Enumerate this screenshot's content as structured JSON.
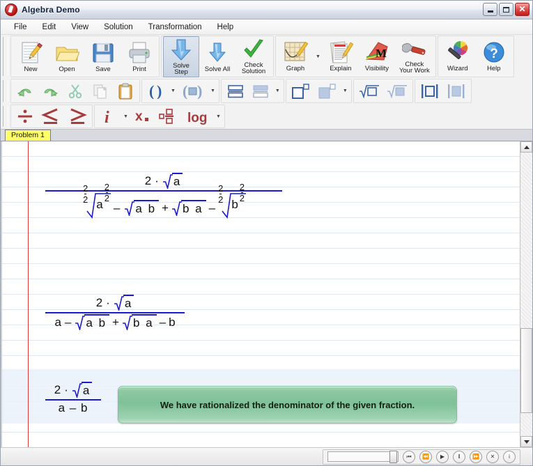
{
  "window": {
    "title": "Algebra Demo",
    "app_icon": "algebra-app-icon",
    "buttons": {
      "minimize": "minimize-button",
      "maximize": "maximize-button",
      "close": "close-button",
      "close_glyph": "✕"
    }
  },
  "menu": {
    "items": [
      "File",
      "Edit",
      "View",
      "Solution",
      "Transformation",
      "Help"
    ]
  },
  "toolbar_row1": {
    "groups": [
      {
        "buttons": [
          {
            "label": "New",
            "icon": "new-document-icon"
          },
          {
            "label": "Open",
            "icon": "open-folder-icon"
          },
          {
            "label": "Save",
            "icon": "floppy-disk-icon"
          },
          {
            "label": "Print",
            "icon": "printer-icon"
          }
        ]
      },
      {
        "buttons": [
          {
            "label": "Solve\nStep",
            "label_line1": "Solve",
            "label_line2": "Step",
            "icon": "solve-step-arrow-icon",
            "state": "active"
          },
          {
            "label": "Solve All",
            "icon": "solve-all-arrow-icon"
          },
          {
            "label": "Check\nSolution",
            "label_line1": "Check",
            "label_line2": "Solution",
            "icon": "green-check-icon"
          }
        ]
      },
      {
        "buttons": [
          {
            "label": "Graph",
            "icon": "graph-plot-icon",
            "has_dropdown": true
          },
          {
            "label": "Explain",
            "icon": "explain-document-icon"
          },
          {
            "label": "Visibility",
            "icon": "visibility-m-icon"
          },
          {
            "label": "Check\nYour Work",
            "label_line1": "Check",
            "label_line2": "Your Work",
            "icon": "wrench-icon"
          }
        ]
      },
      {
        "buttons": [
          {
            "label": "Wizard",
            "icon": "magic-wand-icon"
          },
          {
            "label": "Help",
            "icon": "help-question-icon"
          }
        ]
      }
    ]
  },
  "toolbar_row2": {
    "groups": [
      {
        "buttons": [
          {
            "icon": "undo-icon",
            "glyph": "↶",
            "disabled": false
          },
          {
            "icon": "redo-icon",
            "glyph": "↷",
            "disabled": false
          },
          {
            "icon": "scissors-cut-icon",
            "glyph": "✂",
            "disabled": true
          },
          {
            "icon": "copy-icon",
            "disabled": true
          },
          {
            "icon": "paste-clipboard-icon",
            "disabled": false
          }
        ]
      },
      {
        "buttons": [
          {
            "icon": "parentheses-icon",
            "glyph": "( )",
            "has_dropdown": true
          },
          {
            "icon": "parentheses-filled-icon",
            "glyph": "(■)",
            "has_dropdown": true
          }
        ]
      },
      {
        "buttons": [
          {
            "icon": "stack-equal-icon"
          },
          {
            "icon": "stack-align-icon",
            "has_dropdown": true
          }
        ]
      },
      {
        "buttons": [
          {
            "icon": "power-square-icon"
          },
          {
            "icon": "power-filled-square-icon",
            "has_dropdown": true
          }
        ]
      },
      {
        "buttons": [
          {
            "icon": "nth-root-icon"
          },
          {
            "icon": "nth-root-filled-icon"
          }
        ]
      },
      {
        "buttons": [
          {
            "icon": "absolute-value-icon"
          },
          {
            "icon": "absolute-value-filled-icon"
          }
        ]
      }
    ]
  },
  "toolbar_row3": {
    "groups": [
      {
        "buttons": [
          {
            "icon": "divide-icon",
            "glyph": "÷"
          },
          {
            "icon": "less-equal-icon",
            "glyph": "≤"
          },
          {
            "icon": "greater-equal-icon",
            "glyph": "≥"
          }
        ]
      },
      {
        "buttons": [
          {
            "icon": "imaginary-unit-icon",
            "glyph": "i",
            "has_dropdown": true
          },
          {
            "icon": "subscript-x-icon",
            "glyph": "x"
          },
          {
            "icon": "mixed-fraction-icon"
          },
          {
            "icon": "log-icon",
            "glyph": "log",
            "has_dropdown": true
          }
        ]
      }
    ]
  },
  "tabs": {
    "items": [
      {
        "label": "Problem 1",
        "selected": true
      }
    ]
  },
  "worksheet": {
    "steps": [
      {
        "id": "step-1",
        "type": "fraction",
        "numerator": "2 · √a",
        "denominator": "²⁄₂√(a^(2/2)) − √(a b) + √(b a) − ²⁄₂√(b^(2/2))",
        "numerator_tokens": {
          "coef": "2",
          "dot": "·",
          "radicand": "a"
        },
        "denominator_tokens": [
          {
            "kind": "radical",
            "index_num": "2",
            "index_den": "2",
            "radicand_base": "a",
            "radicand_exp_num": "2",
            "radicand_exp_den": "2"
          },
          {
            "kind": "op",
            "text": "–"
          },
          {
            "kind": "radical",
            "radicand": "a b"
          },
          {
            "kind": "op",
            "text": "+"
          },
          {
            "kind": "radical",
            "radicand": "b a"
          },
          {
            "kind": "op",
            "text": "–"
          },
          {
            "kind": "radical",
            "index_num": "2",
            "index_den": "2",
            "radicand_base": "b",
            "radicand_exp_num": "2",
            "radicand_exp_den": "2"
          }
        ]
      },
      {
        "id": "step-2",
        "type": "fraction",
        "numerator": "2 · √a",
        "denominator": "a − √(a b) + √(b a) − b",
        "numerator_tokens": {
          "coef": "2",
          "dot": "·",
          "radicand": "a"
        },
        "denominator_tokens": [
          {
            "kind": "term",
            "text": "a"
          },
          {
            "kind": "op",
            "text": "–"
          },
          {
            "kind": "radical",
            "radicand": "a b"
          },
          {
            "kind": "op",
            "text": "+"
          },
          {
            "kind": "radical",
            "radicand": "b a"
          },
          {
            "kind": "op",
            "text": "–"
          },
          {
            "kind": "term",
            "text": "b"
          }
        ]
      },
      {
        "id": "step-3",
        "type": "fraction",
        "numerator": "2 · √a",
        "denominator": "a – b",
        "numerator_tokens": {
          "coef": "2",
          "dot": "·",
          "radicand": "a"
        },
        "denominator_tokens": [
          {
            "kind": "term",
            "text": "a – b"
          }
        ]
      }
    ],
    "message": "We have rationalized the denominator of the given fraction.",
    "colors": {
      "math_blue": "#1a1ad0",
      "margin_red": "#e03a3a",
      "rule_blue": "#dfe6ef",
      "bubble_green": "#7ec198"
    }
  },
  "scrollbar": {
    "up_arrow": "scroll-up-arrow",
    "down_arrow": "scroll-down-arrow",
    "thumb": "scroll-thumb"
  },
  "statusbar": {
    "player": {
      "slider_value": "100",
      "buttons": [
        {
          "name": "go-to-start-button",
          "glyph": "⏮"
        },
        {
          "name": "rewind-button",
          "glyph": "⏪"
        },
        {
          "name": "play-button",
          "glyph": "▶"
        },
        {
          "name": "pause-button",
          "glyph": "‖"
        },
        {
          "name": "fast-forward-button",
          "glyph": "⏩"
        },
        {
          "name": "stop-button",
          "glyph": "✕"
        },
        {
          "name": "info-button",
          "glyph": "i"
        }
      ]
    }
  }
}
